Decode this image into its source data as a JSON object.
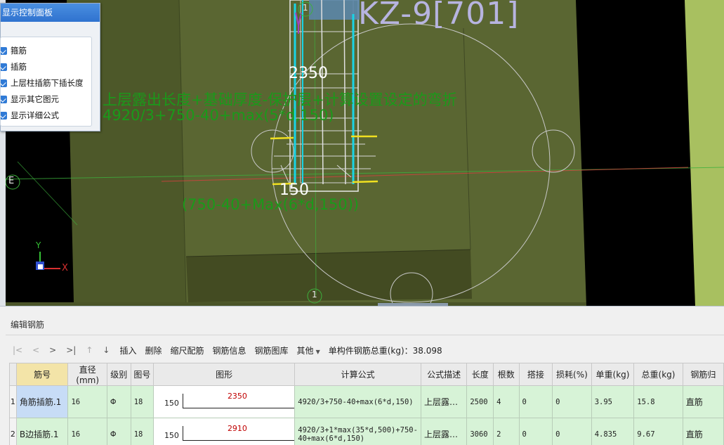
{
  "viewport": {
    "column_label": "KZ-9[701]",
    "axis_top": "1",
    "axis_bottom": "1",
    "axis_left": "E",
    "dim_top": "2350",
    "dim_bottom": "150",
    "formula_desc": "上层露出长度+基础厚度-保护层+计算设置设定的弯折",
    "formula_calc": "4920/3+750-40+max(5*d,150)",
    "formula_bottom": "(750-40+Max(6*d,150))",
    "axis_y": "Y",
    "axis_x": "X"
  },
  "display_panel": {
    "title": "显示控制面板",
    "items": [
      {
        "label": "箍筋",
        "checked": true
      },
      {
        "label": "插筋",
        "checked": true
      },
      {
        "label": "上层柱插筋下插长度",
        "checked": true
      },
      {
        "label": "显示其它图元",
        "checked": true
      },
      {
        "label": "显示详细公式",
        "checked": true
      }
    ]
  },
  "editor": {
    "title": "编辑钢筋",
    "nav": [
      "|<",
      "<",
      ">",
      ">|",
      "↑",
      "↓"
    ],
    "buttons": [
      "插入",
      "删除",
      "缩尺配筋",
      "钢筋信息",
      "钢筋图库",
      "其他"
    ],
    "total_label": "单构件钢筋总重(kg)：38.098",
    "columns": [
      "筋号",
      "直径(mm)",
      "级别",
      "图号",
      "图形",
      "计算公式",
      "公式描述",
      "长度",
      "根数",
      "搭接",
      "损耗(%)",
      "单重(kg)",
      "总重(kg)",
      "钢筋归"
    ],
    "rows": [
      {
        "row_no": "1",
        "name": "角筋插筋.1",
        "diameter": "16",
        "grade": "Φ",
        "figure_no": "18",
        "shape_left": "150",
        "shape_value": "2350",
        "formula": "4920/3+750-40+max(6*d,150)",
        "desc": "上层露…",
        "length": "2500",
        "count": "4",
        "lap": "0",
        "loss": "0",
        "unit_weight": "3.95",
        "total_weight": "15.8",
        "category": "直筋"
      },
      {
        "row_no": "2",
        "name": "B边插筋.1",
        "diameter": "16",
        "grade": "Φ",
        "figure_no": "18",
        "shape_left": "150",
        "shape_value": "2910",
        "formula": "4920/3+1*max(35*d,500)+750-40+max(6*d,150)",
        "desc": "上层露…",
        "length": "3060",
        "count": "2",
        "lap": "0",
        "loss": "0",
        "unit_weight": "4.835",
        "total_weight": "9.67",
        "category": "直筋"
      }
    ]
  },
  "colors": {
    "ground": "#4f5a2c",
    "column_fill": "#5d6a36",
    "rebar_cyan": "#19d4e6",
    "dim_green": "#1a9a1a",
    "label_lilac": "#b7b4e0",
    "row_green": "#d7f3d7"
  }
}
